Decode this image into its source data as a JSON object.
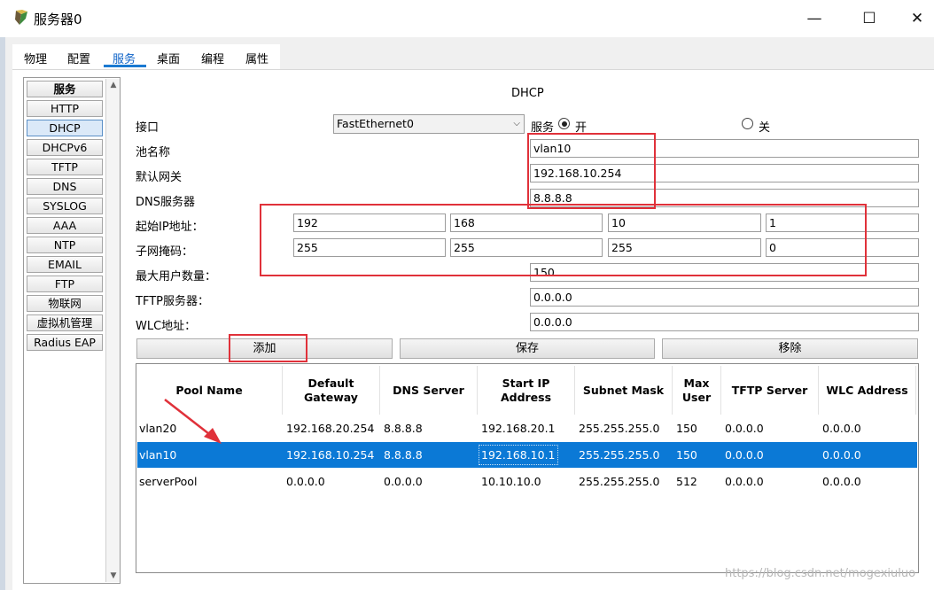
{
  "window": {
    "title": "服务器0",
    "controls": {
      "minimize": "—",
      "maximize": "☐",
      "close": "✕"
    }
  },
  "tabs": [
    "物理",
    "配置",
    "服务",
    "桌面",
    "编程",
    "属性"
  ],
  "active_tab": "服务",
  "sidebar": {
    "items": [
      "服务",
      "HTTP",
      "DHCP",
      "DHCPv6",
      "TFTP",
      "DNS",
      "SYSLOG",
      "AAA",
      "NTP",
      "EMAIL",
      "FTP",
      "物联网",
      "虚拟机管理",
      "Radius EAP"
    ],
    "selected": "DHCP"
  },
  "dhcp": {
    "title": "DHCP",
    "interface_label": "接口",
    "interface_value": "FastEthernet0",
    "service_label": "服务",
    "on_label": "开",
    "off_label": "关",
    "service_state": "on",
    "pool_name_label": "池名称",
    "pool_name": "vlan10",
    "gateway_label": "默认网关",
    "gateway": "192.168.10.254",
    "dns_label": "DNS服务器",
    "dns": "8.8.8.8",
    "start_ip_label": "起始IP地址：",
    "start_ip": [
      "192",
      "168",
      "10",
      "1"
    ],
    "mask_label": "子网掩码：",
    "mask": [
      "255",
      "255",
      "255",
      "0"
    ],
    "max_users_label": "最大用户数量：",
    "max_users": "150",
    "tftp_label": "TFTP服务器：",
    "tftp": "0.0.0.0",
    "wlc_label": "WLC地址：",
    "wlc": "0.0.0.0",
    "buttons": {
      "add": "添加",
      "save": "保存",
      "remove": "移除"
    }
  },
  "table": {
    "headers": [
      "Pool Name",
      "Default Gateway",
      "DNS Server",
      "Start IP Address",
      "Subnet Mask",
      "Max User",
      "TFTP Server",
      "WLC Address"
    ],
    "rows": [
      [
        "vlan20",
        "192.168.20.254",
        "8.8.8.8",
        "192.168.20.1",
        "255.255.255.0",
        "150",
        "0.0.0.0",
        "0.0.0.0"
      ],
      [
        "vlan10",
        "192.168.10.254",
        "8.8.8.8",
        "192.168.10.1",
        "255.255.255.0",
        "150",
        "0.0.0.0",
        "0.0.0.0"
      ],
      [
        "serverPool",
        "0.0.0.0",
        "0.0.0.0",
        "10.10.10.0",
        "255.255.255.0",
        "512",
        "0.0.0.0",
        "0.0.0.0"
      ]
    ],
    "selected_row": 1
  },
  "watermark": "https://blog.csdn.net/mogexiuluo",
  "colors": {
    "accent": "#0b79d6",
    "annotation": "#e0313a",
    "tab_active": "#0d62c7"
  }
}
